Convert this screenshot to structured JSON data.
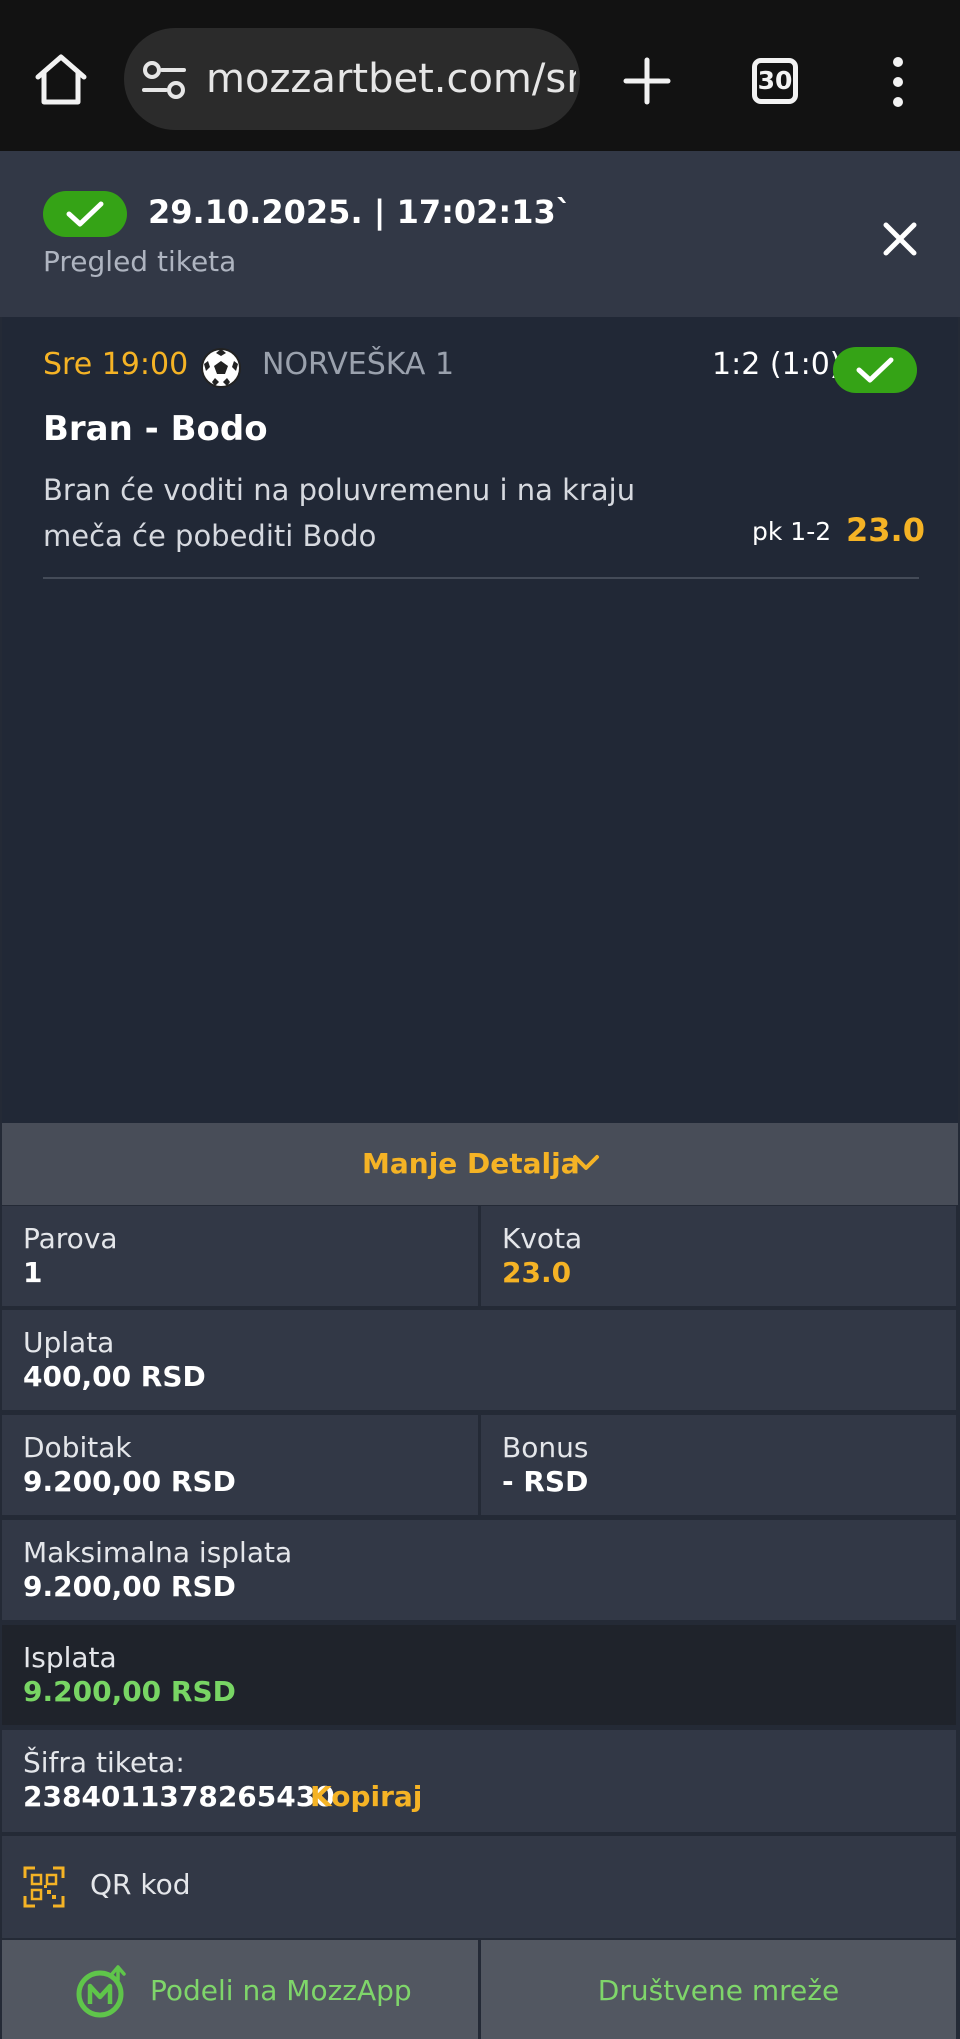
{
  "browser": {
    "url": "mozzartbet.com/sr/",
    "tab_count": "30"
  },
  "ticket": {
    "datetime": "29.10.2025. | 17:02:13`",
    "subtitle": "Pregled tiketa"
  },
  "event": {
    "time": "Sre 19:00",
    "league": "NORVEŠKA 1",
    "score": "1:2 (1:0)",
    "match": "Bran - Bodo",
    "description": "Bran će voditi na poluvremenu i na kraju meča će pobediti Bodo",
    "pick": "pk 1-2",
    "odds": "23.0"
  },
  "details_toggle": {
    "label": "Manje Detalja"
  },
  "info": {
    "parova_label": "Parova",
    "parova_value": "1",
    "kvota_label": "Kvota",
    "kvota_value": "23.0",
    "uplata_label": "Uplata",
    "uplata_value": "400,00 RSD",
    "dobitak_label": "Dobitak",
    "dobitak_value": "9.200,00 RSD",
    "bonus_label": "Bonus",
    "bonus_value": "- RSD",
    "max_label": "Maksimalna isplata",
    "max_value": "9.200,00 RSD",
    "isplata_label": "Isplata",
    "isplata_value": "9.200,00 RSD",
    "sifra_label": "Šifra tiketa:",
    "sifra_value": "2384011378265430",
    "kopiraj_label": "Kopiraj",
    "qr_label": "QR kod"
  },
  "buttons": {
    "share_mozzapp": "Podeli na MozzApp",
    "social": "Društvene mreže"
  },
  "colors": {
    "accent_yellow": "#f5b325",
    "success_green": "#35a316",
    "payout_green": "#78d564"
  }
}
